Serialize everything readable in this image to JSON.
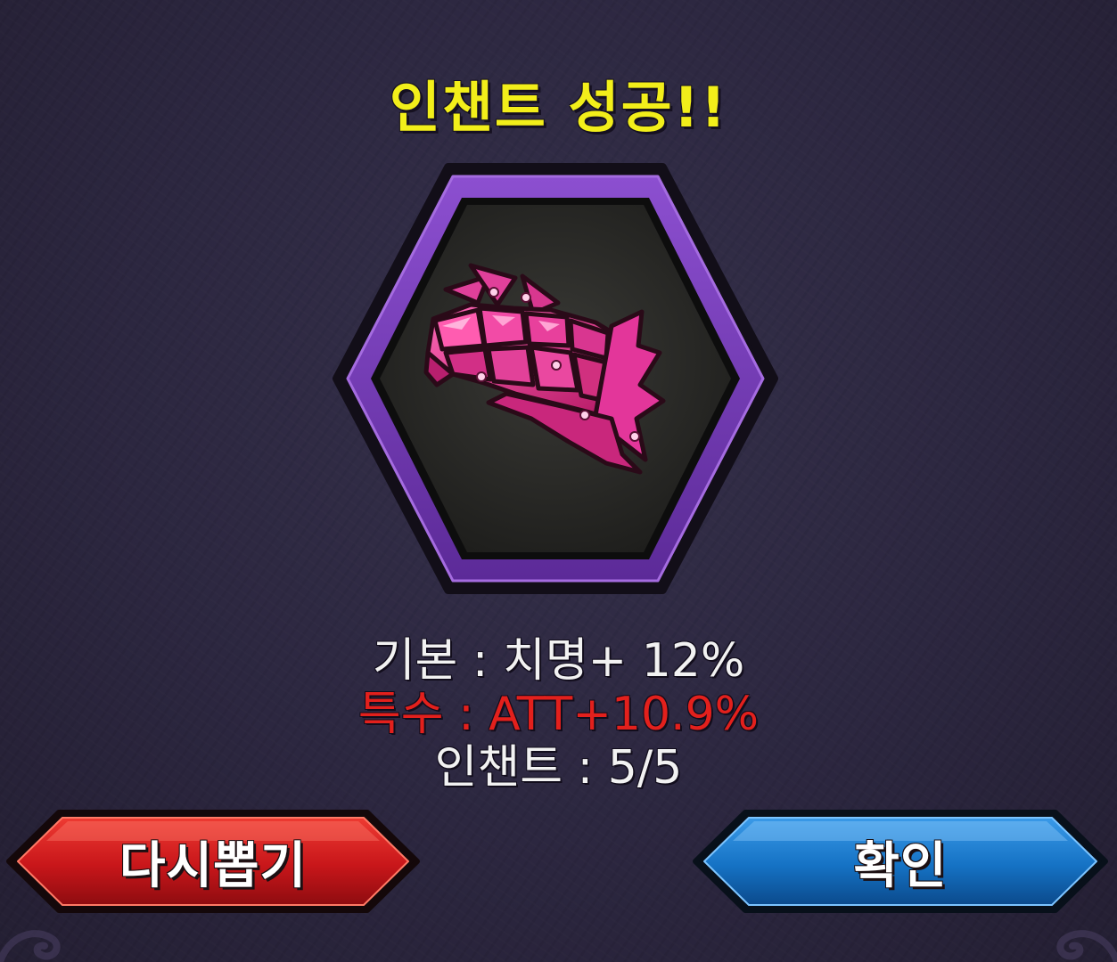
{
  "popup": {
    "title": "인챈트 성공!!",
    "item_icon": "pink-dragon-scale-gauntlet-icon",
    "frame_color": "#7a3fb8",
    "stats": {
      "base": "기본 : 치명+ 12%",
      "special": "특수 : ATT+10.9%",
      "enchant": "인챈트 : 5/5"
    }
  },
  "buttons": {
    "redraw_label": "다시뽑기",
    "confirm_label": "확인"
  },
  "colors": {
    "title": "#f2ee1a",
    "special_stat": "#e3201c",
    "redraw_button": "#c8161a",
    "confirm_button": "#1572c4"
  }
}
